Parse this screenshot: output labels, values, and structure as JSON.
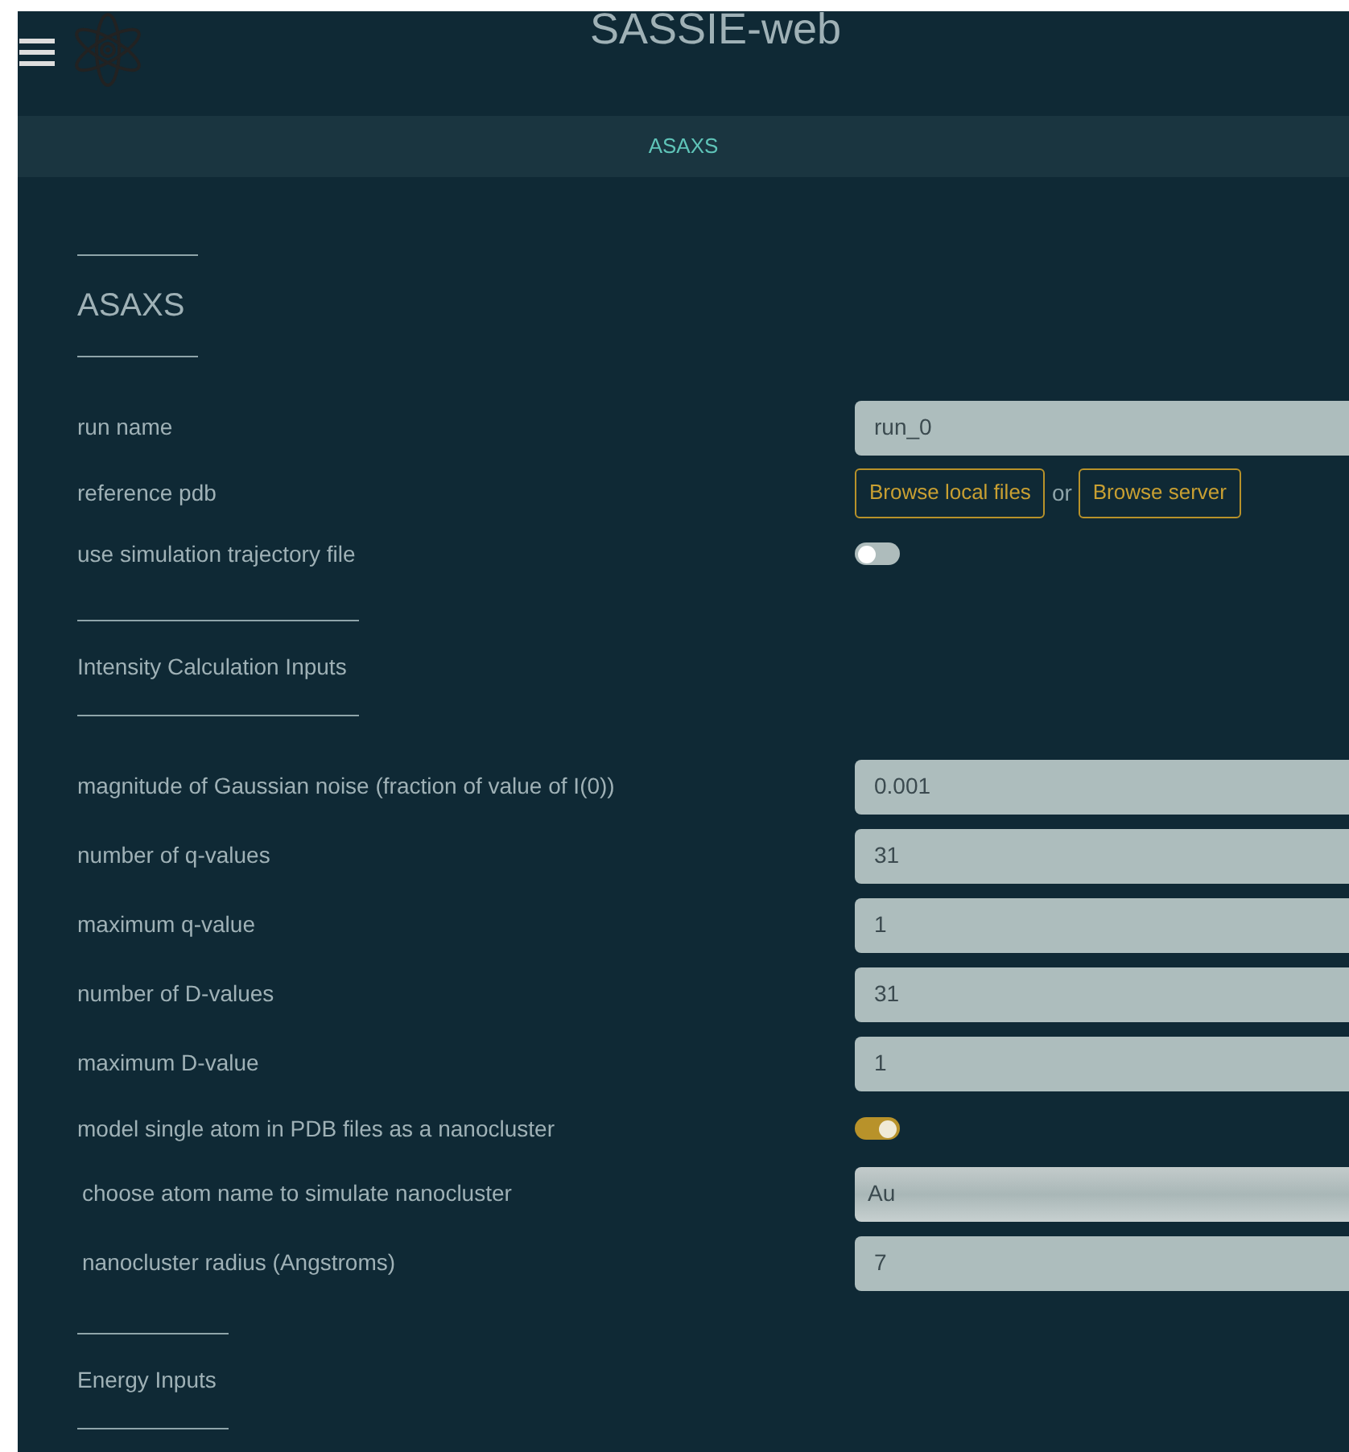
{
  "header": {
    "title": "SASSIE-web"
  },
  "nav": {
    "label": "ASAXS"
  },
  "sections": [
    {
      "heading": "ASAXS",
      "kind": "title",
      "rows": [
        {
          "label": "run name",
          "kind": "text",
          "value": "run_0"
        },
        {
          "label": "reference pdb",
          "kind": "files",
          "buttons": [
            "Browse local files",
            "Browse server"
          ],
          "separator": "or"
        },
        {
          "label": "use simulation trajectory file",
          "kind": "toggle",
          "on": false
        }
      ]
    },
    {
      "heading": "Intensity Calculation Inputs",
      "kind": "subtitle",
      "rows": [
        {
          "label": "magnitude of Gaussian noise (fraction of value of I(0))",
          "kind": "text",
          "value": "0.001"
        },
        {
          "label": "number of q-values",
          "kind": "text",
          "value": "31"
        },
        {
          "label": "maximum q-value",
          "kind": "text",
          "value": "1"
        },
        {
          "label": "number of D-values",
          "kind": "text",
          "value": "31"
        },
        {
          "label": "maximum D-value",
          "kind": "text",
          "value": "1"
        },
        {
          "label": "model single atom in PDB files as a nanocluster",
          "kind": "toggle",
          "on": true
        },
        {
          "label": "choose atom name to simulate nanocluster",
          "kind": "select",
          "value": "Au"
        },
        {
          "label": "nanocluster radius (Angstroms)",
          "kind": "text",
          "value": "7"
        }
      ]
    },
    {
      "heading": "Energy Inputs",
      "kind": "subtitle"
    }
  ]
}
